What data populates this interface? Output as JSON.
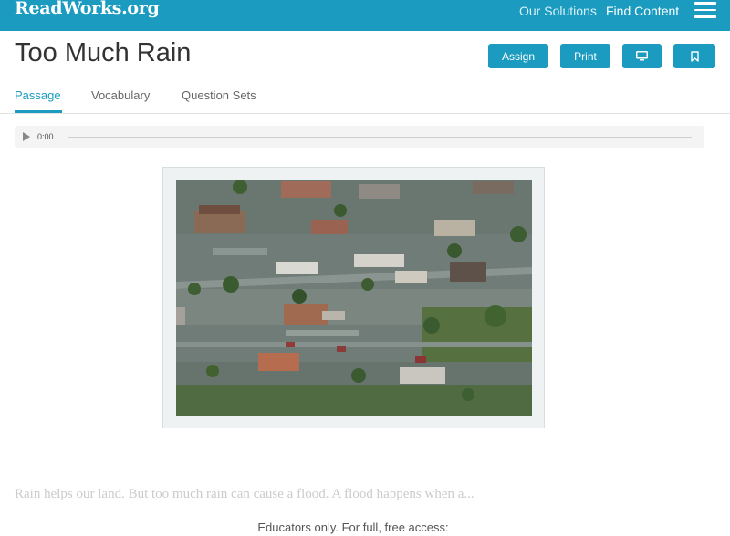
{
  "header": {
    "logo": "ReadWorks.org",
    "nav": [
      "Our Solutions",
      "Find Content"
    ],
    "menu_icon": "hamburger-menu-icon"
  },
  "article": {
    "title": "Too Much Rain",
    "actions": {
      "assign_label": "Assign",
      "print_label": "Print",
      "display_icon": "monitor-icon",
      "bookmark_icon": "bookmark-icon"
    }
  },
  "tabs": [
    {
      "label": "Passage",
      "active": true
    },
    {
      "label": "Vocabulary",
      "active": false
    },
    {
      "label": "Question Sets",
      "active": false
    }
  ],
  "audio": {
    "time": "0:00",
    "play_icon": "play-icon"
  },
  "passage": {
    "preview": "Rain helps our land. But too much rain can cause a flood. A flood happens when a...",
    "notice": "Educators only. For full, free access:"
  },
  "colors": {
    "brand": "#1a9bbf",
    "text": "#333333"
  }
}
